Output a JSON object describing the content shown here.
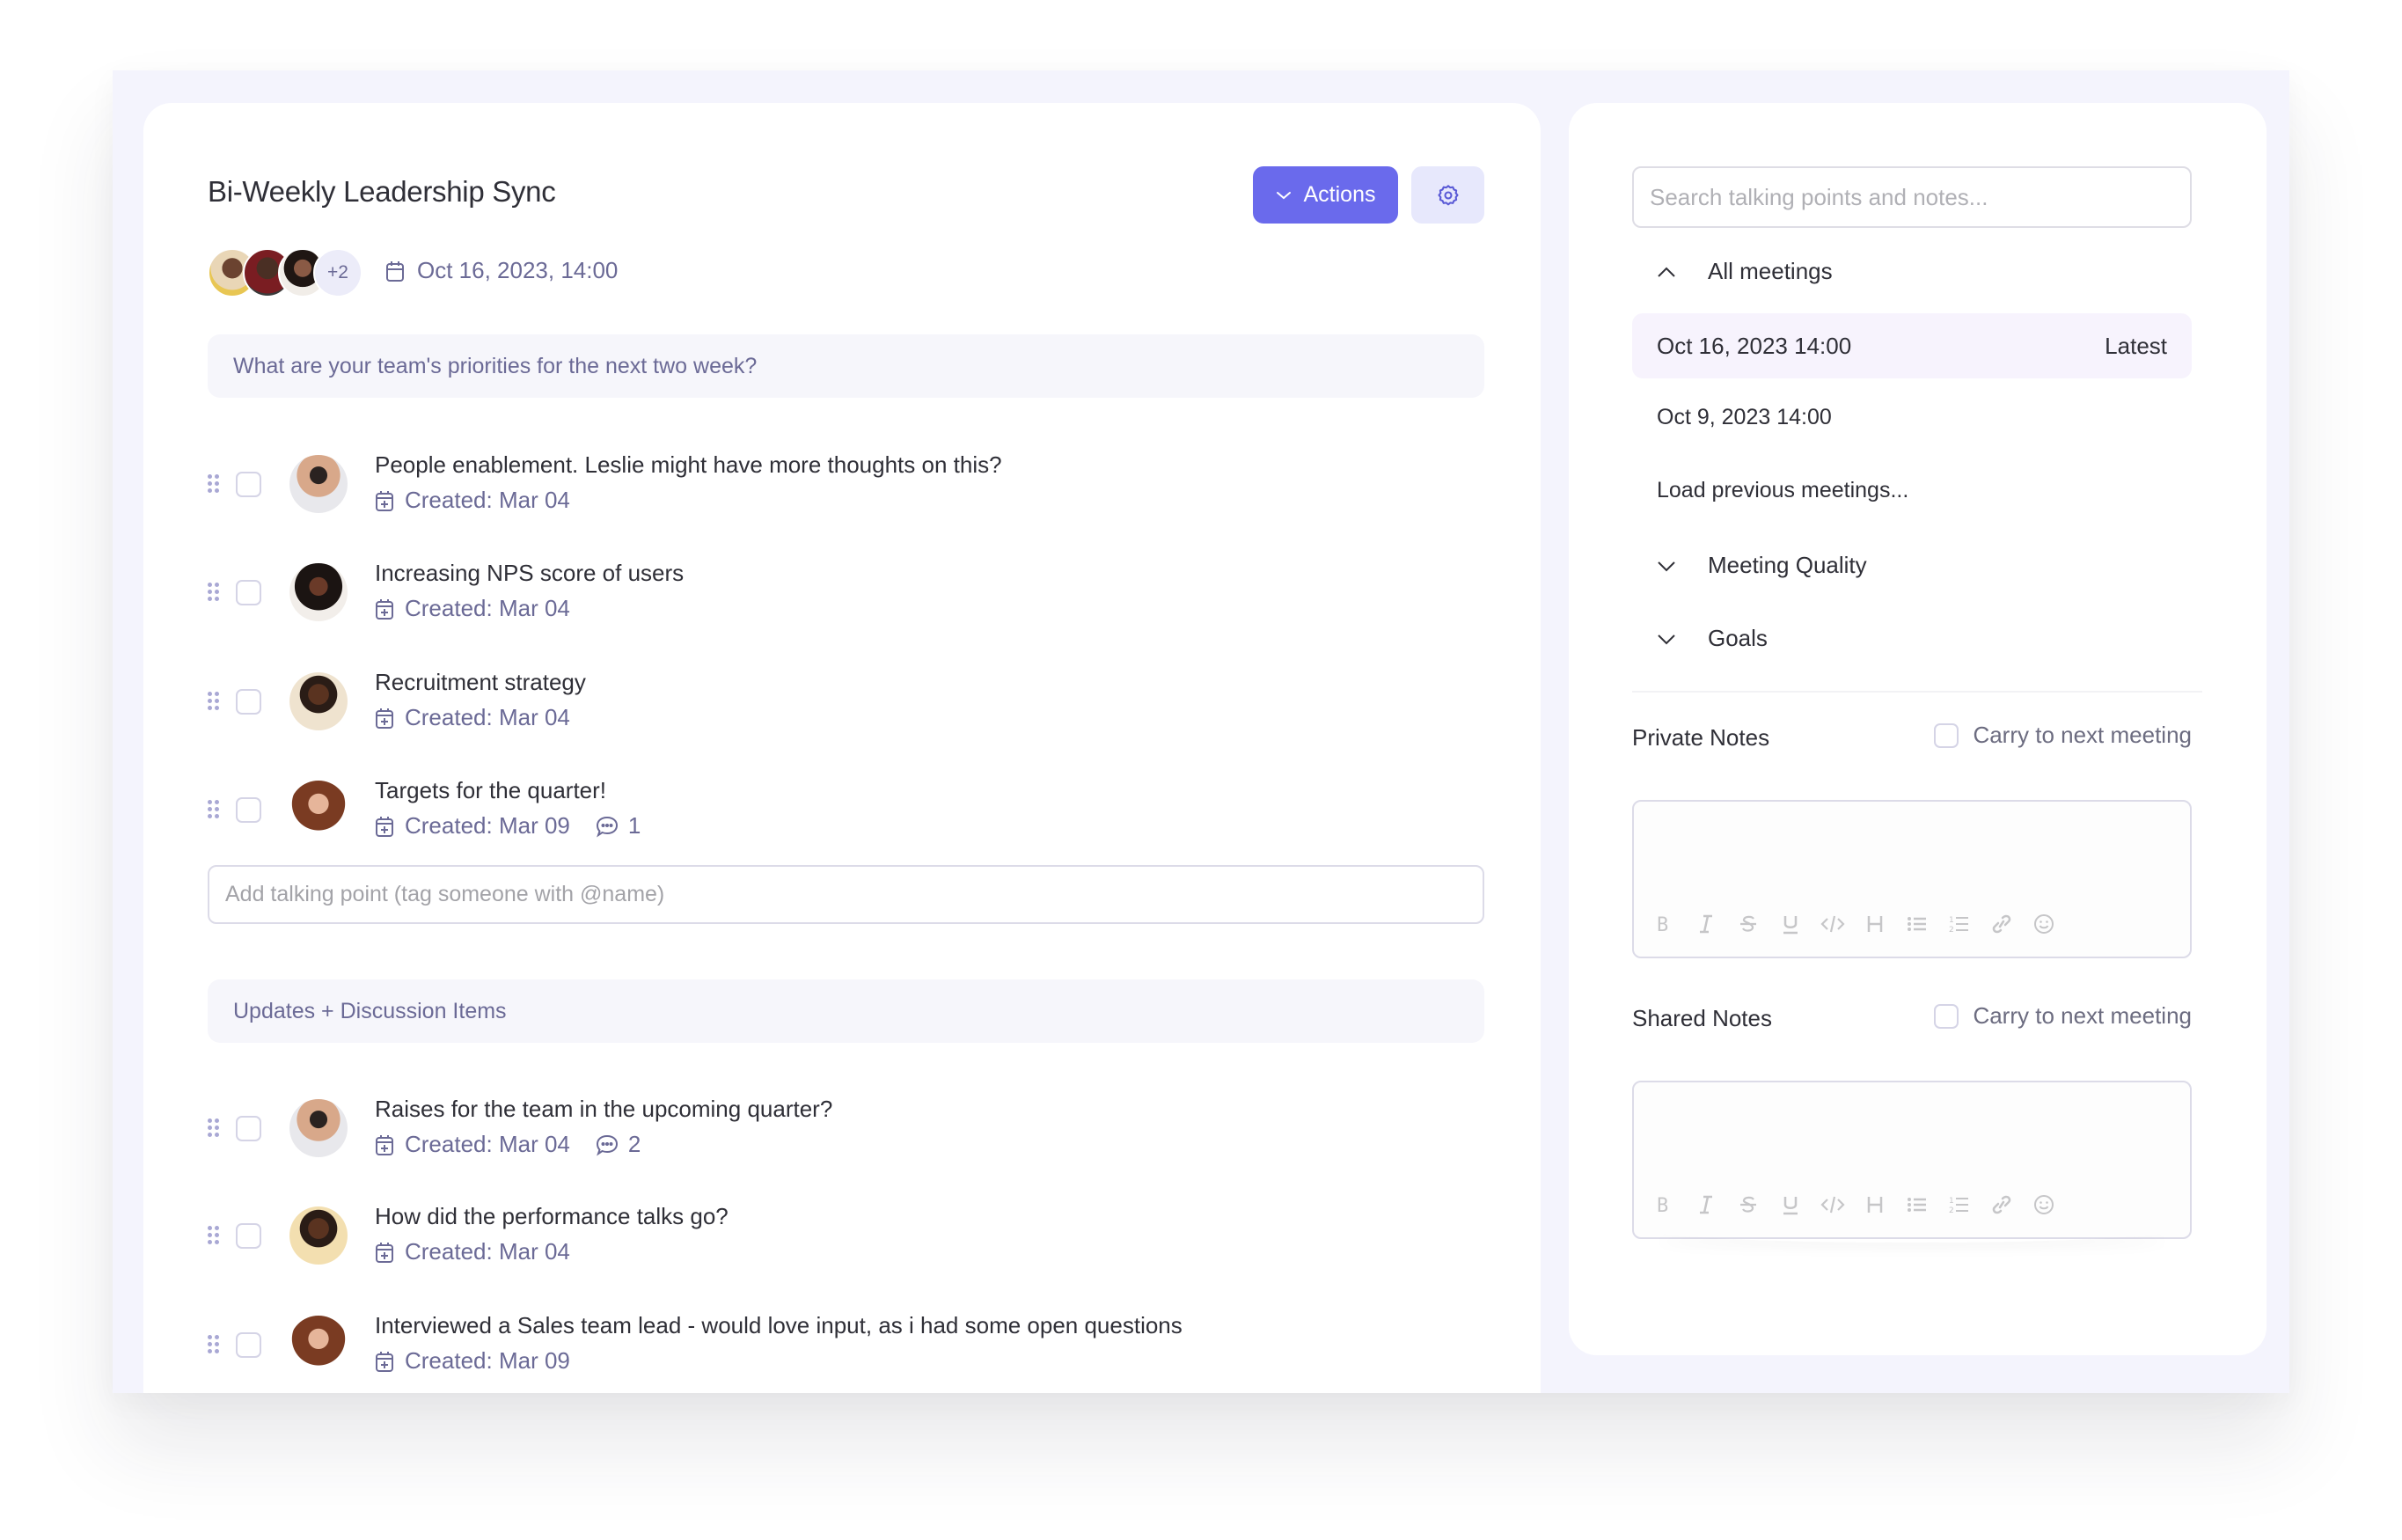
{
  "meeting": {
    "title": "Bi-Weekly Leadership Sync",
    "date": "Oct 16, 2023, 14:00",
    "extra_attendees": "+2",
    "actions_label": "Actions"
  },
  "colors": {
    "accent": "#6a6aec",
    "accent_soft": "#e7e8fc",
    "meta_text": "#6b6a96",
    "frame_bg": "#f4f4fd"
  },
  "sections": [
    {
      "header": "What are your team's priorities for the next two week?",
      "items": [
        {
          "text": "People enablement. Leslie might have more thoughts on this?",
          "created": "Created: Mar 04",
          "comments": null
        },
        {
          "text": "Increasing NPS score of users",
          "created": "Created: Mar 04",
          "comments": null
        },
        {
          "text": "Recruitment strategy",
          "created": "Created: Mar 04",
          "comments": null
        },
        {
          "text": "Targets for the quarter!",
          "created": "Created: Mar 09",
          "comments": "1"
        }
      ],
      "add_placeholder": "Add talking point (tag someone with @name)"
    },
    {
      "header": "Updates + Discussion Items",
      "items": [
        {
          "text": "Raises for the team in the upcoming quarter?",
          "created": "Created: Mar 04",
          "comments": "2"
        },
        {
          "text": "How did the performance talks go?",
          "created": "Created: Mar 04",
          "comments": null
        },
        {
          "text": "Interviewed a Sales team lead - would love input, as i had some open questions",
          "created": "Created: Mar 09",
          "comments": null
        }
      ]
    }
  ],
  "sidebar": {
    "search_placeholder": "Search talking points and notes...",
    "all_meetings_label": "All meetings",
    "meetings": [
      {
        "date": "Oct 16, 2023 14:00",
        "badge": "Latest"
      },
      {
        "date": "Oct 9, 2023 14:00",
        "badge": ""
      }
    ],
    "load_previous": "Load previous meetings...",
    "meeting_quality_label": "Meeting Quality",
    "goals_label": "Goals",
    "private_notes_label": "Private Notes",
    "shared_notes_label": "Shared Notes",
    "carry_label": "Carry to next meeting",
    "toolbar_icons": [
      "bold-icon",
      "italic-icon",
      "strikethrough-icon",
      "underline-icon",
      "code-icon",
      "heading-icon",
      "bullet-list-icon",
      "numbered-list-icon",
      "link-icon",
      "emoji-icon"
    ]
  }
}
